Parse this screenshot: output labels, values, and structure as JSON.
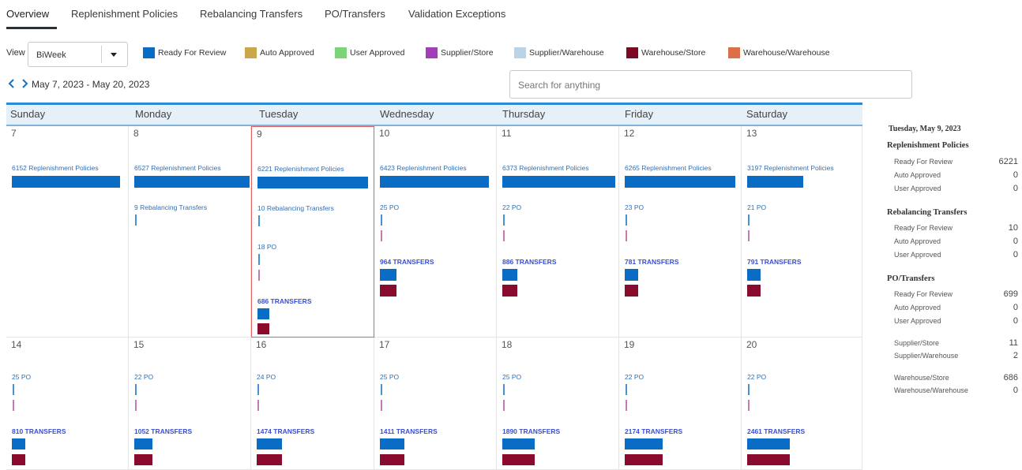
{
  "tabs": [
    "Overview",
    "Replenishment Policies",
    "Rebalancing Transfers",
    "PO/Transfers",
    "Validation Exceptions"
  ],
  "toolbar": {
    "view_label": "View",
    "view_value": "BiWeek",
    "date_range": "May 7, 2023 - May 20, 2023",
    "search_placeholder": "Search for anything"
  },
  "legend": [
    {
      "label": "Ready For Review",
      "color": "#0a6cc4"
    },
    {
      "label": "Auto Approved",
      "color": "#c8a84a"
    },
    {
      "label": "User Approved",
      "color": "#7dd37a"
    },
    {
      "label": "Supplier/Store",
      "color": "#a23fb8"
    },
    {
      "label": "Supplier/Warehouse",
      "color": "#b9d4e6"
    },
    {
      "label": "Warehouse/Store",
      "color": "#7d0a24"
    },
    {
      "label": "Warehouse/Warehouse",
      "color": "#d9704a"
    }
  ],
  "calendar": {
    "day_names": [
      "Sunday",
      "Monday",
      "Tuesday",
      "Wednesday",
      "Thursday",
      "Friday",
      "Saturday"
    ],
    "week1": {
      "days": [
        "7",
        "8",
        "9",
        "10",
        "11",
        "12",
        "13"
      ],
      "replenishment": [
        "6152 Replenishment Policies",
        "6527 Replenishment Policies",
        "6221 Replenishment Policies",
        "6423 Replenishment Policies",
        "6373 Replenishment Policies",
        "6265 Replenishment Policies",
        "3197 Replenishment Policies"
      ],
      "rebalancing": [
        "",
        "9 Rebalancing Transfers",
        "10 Rebalancing Transfers",
        "",
        "",
        "",
        ""
      ],
      "po": [
        "",
        "",
        "18 PO",
        "25 PO",
        "22 PO",
        "23 PO",
        "21 PO"
      ],
      "transfers": [
        "",
        "",
        "686 TRANSFERS",
        "964 TRANSFERS",
        "886 TRANSFERS",
        "781 TRANSFERS",
        "791 TRANSFERS"
      ]
    },
    "week2": {
      "days": [
        "14",
        "15",
        "16",
        "17",
        "18",
        "19",
        "20"
      ],
      "po": [
        "25 PO",
        "22 PO",
        "24 PO",
        "25 PO",
        "25 PO",
        "22 PO",
        "22 PO"
      ],
      "transfers": [
        "810 TRANSFERS",
        "1052 TRANSFERS",
        "1474 TRANSFERS",
        "1411 TRANSFERS",
        "1890 TRANSFERS",
        "2174 TRANSFERS",
        "2461 TRANSFERS"
      ]
    }
  },
  "panel": {
    "date": "Tuesday, May 9, 2023",
    "replenishment": {
      "title": "Replenishment Policies",
      "rows": [
        {
          "label": "Ready For Review",
          "value": "6221"
        },
        {
          "label": "Auto Approved",
          "value": "0"
        },
        {
          "label": "User Approved",
          "value": "0"
        }
      ]
    },
    "rebalancing": {
      "title": "Rebalancing Transfers",
      "rows": [
        {
          "label": "Ready For Review",
          "value": "10"
        },
        {
          "label": "Auto Approved",
          "value": "0"
        },
        {
          "label": "User Approved",
          "value": "0"
        }
      ]
    },
    "po_transfers": {
      "title": "PO/Transfers",
      "rows": [
        {
          "label": "Ready For Review",
          "value": "699"
        },
        {
          "label": "Auto Approved",
          "value": "0"
        },
        {
          "label": "User Approved",
          "value": "0"
        }
      ]
    },
    "supplier": {
      "rows": [
        {
          "label": "Supplier/Store",
          "value": "11"
        },
        {
          "label": "Supplier/Warehouse",
          "value": "2"
        }
      ]
    },
    "warehouse": {
      "rows": [
        {
          "label": "Warehouse/Store",
          "value": "686"
        },
        {
          "label": "Warehouse/Warehouse",
          "value": "0"
        }
      ]
    }
  }
}
